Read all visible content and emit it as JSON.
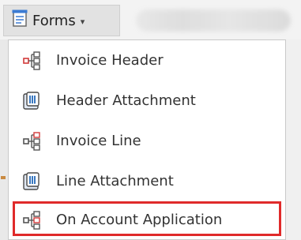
{
  "toolbar": {
    "forms_label": "Forms",
    "forms_caret": "▾",
    "forms_icon": "form-icon"
  },
  "menu": {
    "items": [
      {
        "label": "Invoice Header",
        "icon": "hierarchy-icon"
      },
      {
        "label": "Header Attachment",
        "icon": "attachment-icon"
      },
      {
        "label": "Invoice Line",
        "icon": "hierarchy-icon"
      },
      {
        "label": "Line Attachment",
        "icon": "attachment-icon"
      },
      {
        "label": "On Account Application",
        "icon": "hierarchy-icon"
      }
    ],
    "highlighted_item": "On Account Application"
  },
  "colors": {
    "highlight": "#e02a2a",
    "hierarchy_red": "#d23a3a",
    "attachment_blue": "#3a78c0"
  }
}
